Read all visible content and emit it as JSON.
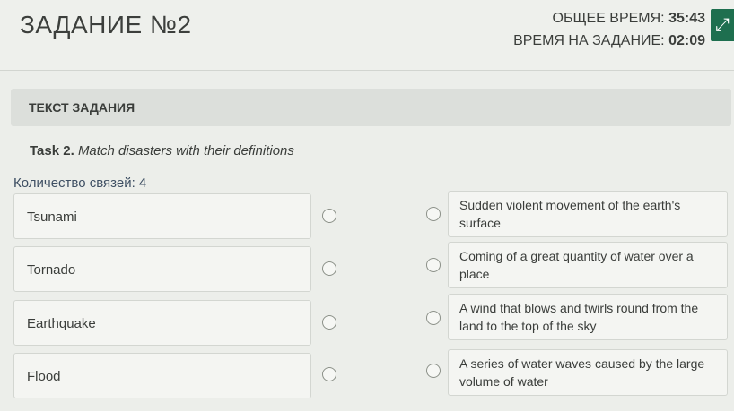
{
  "header": {
    "task_title": "ЗАДАНИЕ №2",
    "total_time_label": "ОБЩЕЕ ВРЕМЯ:",
    "total_time_value": "35:43",
    "task_time_label": "ВРЕМЯ НА ЗАДАНИЕ:",
    "task_time_value": "02:09",
    "fullscreen_icon": "expand-icon"
  },
  "section": {
    "title": "ТЕКСТ ЗАДАНИЯ"
  },
  "task": {
    "number_label": "Task 2.",
    "instruction": "Match disasters with their definitions"
  },
  "links_count": "Количество связей: 4",
  "left_items": [
    "Tsunami",
    "Tornado",
    "Earthquake",
    "Flood"
  ],
  "right_items": [
    "Sudden violent movement of the earth's surface",
    "Coming of a great quantity of water over a place",
    "A wind that blows and twirls round from the land to the top of the sky",
    "A series of water waves caused by the large volume of water"
  ],
  "colors": {
    "accent": "#1e6f4f",
    "background": "#eceeea",
    "card": "#f4f5f2",
    "links_text": "#3e4f63"
  }
}
